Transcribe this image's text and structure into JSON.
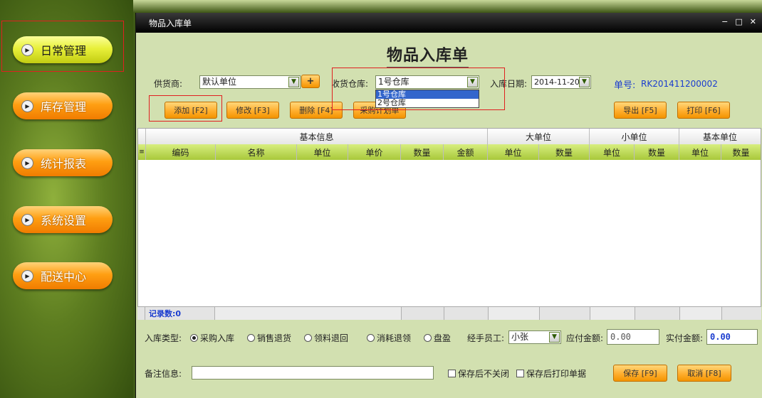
{
  "sidebar": {
    "items": [
      {
        "label": "日常管理",
        "style": "yellow"
      },
      {
        "label": "库存管理",
        "style": "orange"
      },
      {
        "label": "统计报表",
        "style": "orange"
      },
      {
        "label": "系统设置",
        "style": "orange"
      },
      {
        "label": "配送中心",
        "style": "orange"
      }
    ]
  },
  "window": {
    "title": "物品入库单",
    "controls": [
      "−",
      "□",
      "✕"
    ]
  },
  "form": {
    "title": "物品入库单",
    "supplier_label": "供货商:",
    "supplier_value": "默认单位",
    "supplier_add": "+",
    "warehouse_label": "收货仓库:",
    "warehouse_value": "1号仓库",
    "warehouse_options": [
      "1号仓库",
      "2号仓库"
    ],
    "date_label": "入库日期:",
    "date_value": "2014-11-20",
    "order_no_label": "单号:",
    "order_no_value": "RK201411200002"
  },
  "toolbar": {
    "add": "添加 [F2]",
    "edit": "修改 [F3]",
    "delete": "删除 [F4]",
    "purchase_plan": "采购计划单",
    "export": "导出 [F5]",
    "print": "打印 [F6]"
  },
  "grid": {
    "groups": [
      "基本信息",
      "大单位",
      "小单位",
      "基本单位"
    ],
    "columns": [
      "编码",
      "名称",
      "单位",
      "单价",
      "数量",
      "金额",
      "单位",
      "数量",
      "单位",
      "数量",
      "单位",
      "数量"
    ],
    "record_label": "记录数:0"
  },
  "bottom": {
    "type_label": "入库类型:",
    "types": [
      "采购入库",
      "销售退货",
      "领料退回",
      "消耗退领",
      "盘盈"
    ],
    "handler_label": "经手员工:",
    "handler_value": "小张",
    "payable_label": "应付金额:",
    "payable_value": "0.00",
    "paid_label": "实付金额:",
    "paid_value": "0.00",
    "remark_label": "备注信息:",
    "keep_open": "保存后不关闭",
    "print_after": "保存后打印单据",
    "save": "保存 [F9]",
    "cancel": "取消 [F8]"
  },
  "colors": {
    "window_bg": "#d2e0b0",
    "button_orange": "#ffae2e",
    "header_green": "#a8c83a",
    "order_no": "#1a3ccf",
    "highlight_box": "#e02020"
  }
}
